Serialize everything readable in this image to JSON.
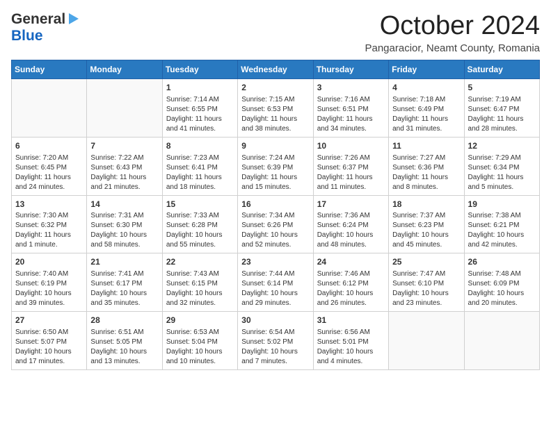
{
  "header": {
    "logo_general": "General",
    "logo_blue": "Blue",
    "month_title": "October 2024",
    "subtitle": "Pangaracior, Neamt County, Romania"
  },
  "weekdays": [
    "Sunday",
    "Monday",
    "Tuesday",
    "Wednesday",
    "Thursday",
    "Friday",
    "Saturday"
  ],
  "weeks": [
    [
      {
        "day": "",
        "info": ""
      },
      {
        "day": "",
        "info": ""
      },
      {
        "day": "1",
        "info": "Sunrise: 7:14 AM\nSunset: 6:55 PM\nDaylight: 11 hours and 41 minutes."
      },
      {
        "day": "2",
        "info": "Sunrise: 7:15 AM\nSunset: 6:53 PM\nDaylight: 11 hours and 38 minutes."
      },
      {
        "day": "3",
        "info": "Sunrise: 7:16 AM\nSunset: 6:51 PM\nDaylight: 11 hours and 34 minutes."
      },
      {
        "day": "4",
        "info": "Sunrise: 7:18 AM\nSunset: 6:49 PM\nDaylight: 11 hours and 31 minutes."
      },
      {
        "day": "5",
        "info": "Sunrise: 7:19 AM\nSunset: 6:47 PM\nDaylight: 11 hours and 28 minutes."
      }
    ],
    [
      {
        "day": "6",
        "info": "Sunrise: 7:20 AM\nSunset: 6:45 PM\nDaylight: 11 hours and 24 minutes."
      },
      {
        "day": "7",
        "info": "Sunrise: 7:22 AM\nSunset: 6:43 PM\nDaylight: 11 hours and 21 minutes."
      },
      {
        "day": "8",
        "info": "Sunrise: 7:23 AM\nSunset: 6:41 PM\nDaylight: 11 hours and 18 minutes."
      },
      {
        "day": "9",
        "info": "Sunrise: 7:24 AM\nSunset: 6:39 PM\nDaylight: 11 hours and 15 minutes."
      },
      {
        "day": "10",
        "info": "Sunrise: 7:26 AM\nSunset: 6:37 PM\nDaylight: 11 hours and 11 minutes."
      },
      {
        "day": "11",
        "info": "Sunrise: 7:27 AM\nSunset: 6:36 PM\nDaylight: 11 hours and 8 minutes."
      },
      {
        "day": "12",
        "info": "Sunrise: 7:29 AM\nSunset: 6:34 PM\nDaylight: 11 hours and 5 minutes."
      }
    ],
    [
      {
        "day": "13",
        "info": "Sunrise: 7:30 AM\nSunset: 6:32 PM\nDaylight: 11 hours and 1 minute."
      },
      {
        "day": "14",
        "info": "Sunrise: 7:31 AM\nSunset: 6:30 PM\nDaylight: 10 hours and 58 minutes."
      },
      {
        "day": "15",
        "info": "Sunrise: 7:33 AM\nSunset: 6:28 PM\nDaylight: 10 hours and 55 minutes."
      },
      {
        "day": "16",
        "info": "Sunrise: 7:34 AM\nSunset: 6:26 PM\nDaylight: 10 hours and 52 minutes."
      },
      {
        "day": "17",
        "info": "Sunrise: 7:36 AM\nSunset: 6:24 PM\nDaylight: 10 hours and 48 minutes."
      },
      {
        "day": "18",
        "info": "Sunrise: 7:37 AM\nSunset: 6:23 PM\nDaylight: 10 hours and 45 minutes."
      },
      {
        "day": "19",
        "info": "Sunrise: 7:38 AM\nSunset: 6:21 PM\nDaylight: 10 hours and 42 minutes."
      }
    ],
    [
      {
        "day": "20",
        "info": "Sunrise: 7:40 AM\nSunset: 6:19 PM\nDaylight: 10 hours and 39 minutes."
      },
      {
        "day": "21",
        "info": "Sunrise: 7:41 AM\nSunset: 6:17 PM\nDaylight: 10 hours and 35 minutes."
      },
      {
        "day": "22",
        "info": "Sunrise: 7:43 AM\nSunset: 6:15 PM\nDaylight: 10 hours and 32 minutes."
      },
      {
        "day": "23",
        "info": "Sunrise: 7:44 AM\nSunset: 6:14 PM\nDaylight: 10 hours and 29 minutes."
      },
      {
        "day": "24",
        "info": "Sunrise: 7:46 AM\nSunset: 6:12 PM\nDaylight: 10 hours and 26 minutes."
      },
      {
        "day": "25",
        "info": "Sunrise: 7:47 AM\nSunset: 6:10 PM\nDaylight: 10 hours and 23 minutes."
      },
      {
        "day": "26",
        "info": "Sunrise: 7:48 AM\nSunset: 6:09 PM\nDaylight: 10 hours and 20 minutes."
      }
    ],
    [
      {
        "day": "27",
        "info": "Sunrise: 6:50 AM\nSunset: 5:07 PM\nDaylight: 10 hours and 17 minutes."
      },
      {
        "day": "28",
        "info": "Sunrise: 6:51 AM\nSunset: 5:05 PM\nDaylight: 10 hours and 13 minutes."
      },
      {
        "day": "29",
        "info": "Sunrise: 6:53 AM\nSunset: 5:04 PM\nDaylight: 10 hours and 10 minutes."
      },
      {
        "day": "30",
        "info": "Sunrise: 6:54 AM\nSunset: 5:02 PM\nDaylight: 10 hours and 7 minutes."
      },
      {
        "day": "31",
        "info": "Sunrise: 6:56 AM\nSunset: 5:01 PM\nDaylight: 10 hours and 4 minutes."
      },
      {
        "day": "",
        "info": ""
      },
      {
        "day": "",
        "info": ""
      }
    ]
  ]
}
